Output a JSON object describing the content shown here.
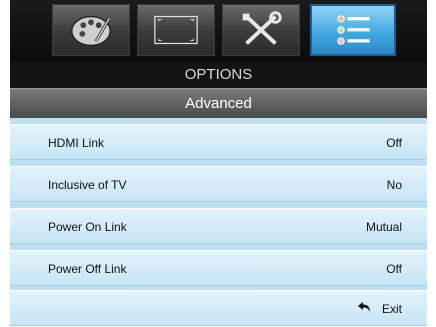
{
  "tabs": [
    {
      "icon": "palette-icon"
    },
    {
      "icon": "screen-frame-icon"
    },
    {
      "icon": "tools-icon"
    },
    {
      "icon": "options-list-icon",
      "selected": true
    }
  ],
  "title": "OPTIONS",
  "subtitle": "Advanced",
  "items": [
    {
      "label": "HDMI Link",
      "value": "Off"
    },
    {
      "label": "Inclusive of TV",
      "value": "No"
    },
    {
      "label": "Power On Link",
      "value": "Mutual"
    },
    {
      "label": "Power Off Link",
      "value": "Off"
    }
  ],
  "exit": {
    "label": "Exit",
    "icon": "return-arrow-icon"
  },
  "colors": {
    "accent": "#3fa6e0",
    "row_bg": "#d6ecf8",
    "header_bg": "#141414"
  }
}
